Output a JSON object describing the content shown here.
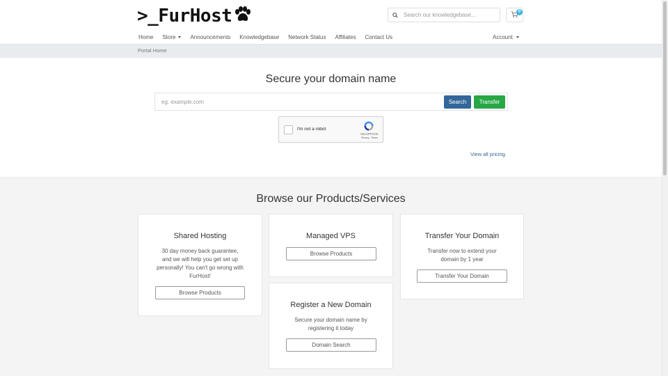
{
  "header": {
    "logo_text": ">_FurHost",
    "search": {
      "placeholder": "Search our knowledgebase..."
    },
    "cart_count": "0"
  },
  "nav": {
    "items": [
      {
        "label": "Home",
        "dropdown": false
      },
      {
        "label": "Store",
        "dropdown": true
      },
      {
        "label": "Announcements",
        "dropdown": false
      },
      {
        "label": "Knowledgebase",
        "dropdown": false
      },
      {
        "label": "Network Status",
        "dropdown": false
      },
      {
        "label": "Affiliates",
        "dropdown": false
      },
      {
        "label": "Contact Us",
        "dropdown": false
      }
    ],
    "account_label": "Account"
  },
  "breadcrumb": {
    "label": "Portal Home"
  },
  "domain": {
    "title": "Secure your domain name",
    "input_placeholder": "eg. example.com",
    "search_label": "Search",
    "transfer_label": "Transfer",
    "view_pricing": "View all pricing"
  },
  "recaptcha": {
    "label": "I'm not a robot",
    "brand": "reCAPTCHA",
    "terms": "Privacy - Terms"
  },
  "products": {
    "title": "Browse our Products/Services",
    "cards": [
      {
        "title": "Shared Hosting",
        "description": "30 day money back guarantee, and we will help you get set up personally! You can't go wrong with FurHost!",
        "button": "Browse Products"
      },
      {
        "title": "Managed VPS",
        "description": "",
        "button": "Browse Products"
      },
      {
        "title": "Transfer Your Domain",
        "description": "Transfer now to extend your domain by 1 year",
        "button": "Transfer Your Domain"
      },
      {
        "title": "Register a New Domain",
        "description": "Secure your domain name by registering it today",
        "button": "Domain Search"
      }
    ]
  },
  "colors": {
    "primary_button": "#336699",
    "success_button": "#28a745",
    "badge": "#3bb6dc",
    "link": "#336699",
    "breadcrumb_bg": "#e9ecef",
    "products_bg": "#f4f4f4"
  }
}
